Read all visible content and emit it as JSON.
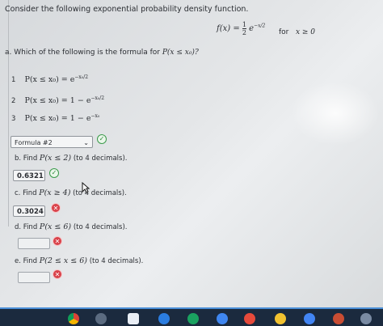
{
  "intro": "Consider the following exponential probability density function.",
  "pdf": {
    "lhs": "f(x) =",
    "num": "1",
    "den": "2",
    "rest": "e",
    "exp": "−x/2"
  },
  "condition": {
    "prefix": "for",
    "expr": "x ≥ 0"
  },
  "part_a": {
    "question": "a. Which of the following is the formula for",
    "target": "P(x ≤ x₀)?",
    "options": [
      {
        "num": "1",
        "expr": "P(x ≤ x₀) = e",
        "exp": "−x₀/2"
      },
      {
        "num": "2",
        "expr": "P(x ≤ x₀) = 1 − e",
        "exp": "−x₀/2"
      },
      {
        "num": "3",
        "expr": "P(x ≤ x₀) = 1 − e",
        "exp": "−x₀"
      }
    ],
    "selected": "Formula #2",
    "status": "correct"
  },
  "part_b": {
    "prefix": "b. Find",
    "expr": "P(x ≤ 2)",
    "suffix": "(to 4 decimals).",
    "value": "0.6321",
    "status": "correct"
  },
  "part_c": {
    "prefix": "c. Find",
    "expr": "P(x ≥ 4)",
    "suffix": "(to 4 decimals).",
    "value": "0.3024",
    "status": "incorrect"
  },
  "part_d": {
    "prefix": "d. Find",
    "expr": "P(x ≤ 6)",
    "suffix": "(to 4 decimals).",
    "value": "",
    "status": "incorrect"
  },
  "part_e": {
    "prefix": "e. Find",
    "expr": "P(2 ≤ x ≤ 6)",
    "suffix": "(to 4 decimals).",
    "value": "",
    "status": "incorrect"
  },
  "icons": {
    "correct": "✓",
    "incorrect": "✕",
    "dropdown": "⌄",
    "cursor": "pointer-cursor-icon"
  },
  "colors": {
    "correct": "#3a9a4a",
    "incorrect": "#d9424a",
    "taskbar": "#1b2a3e"
  }
}
